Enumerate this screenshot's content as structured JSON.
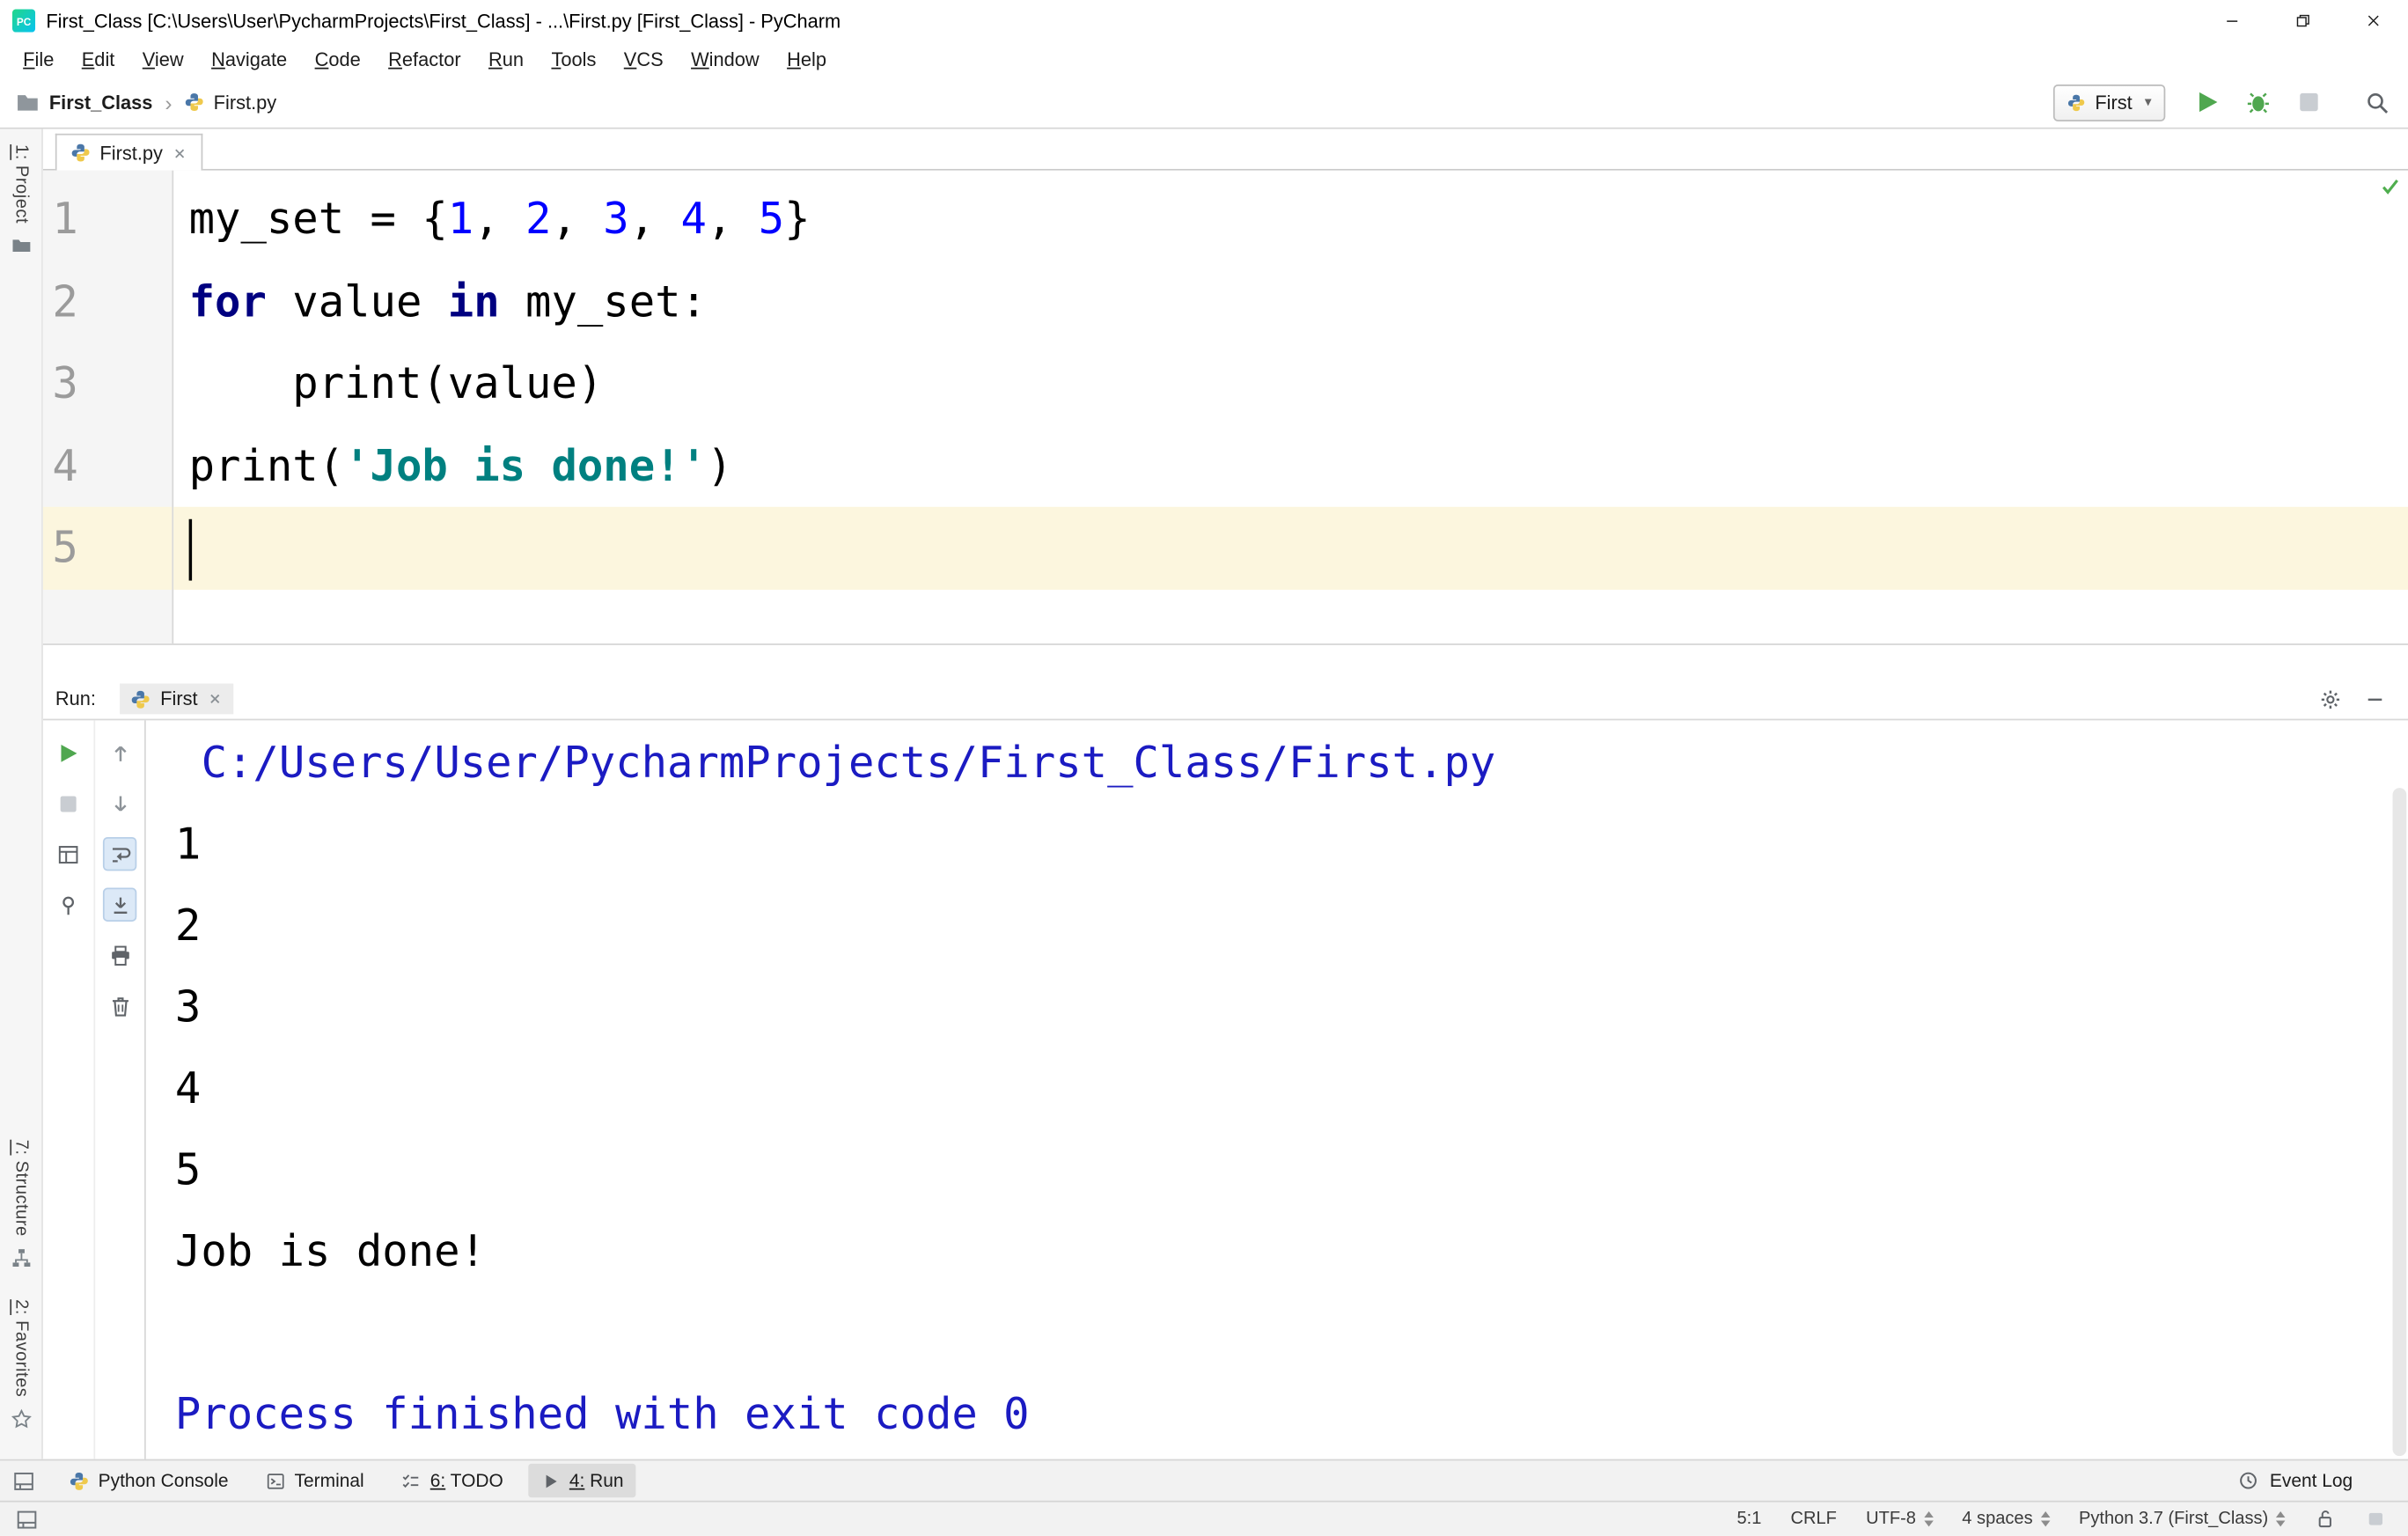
{
  "window": {
    "title": "First_Class [C:\\Users\\User\\PycharmProjects\\First_Class] - ...\\First.py [First_Class] - PyCharm"
  },
  "menubar": {
    "items": [
      "File",
      "Edit",
      "View",
      "Navigate",
      "Code",
      "Refactor",
      "Run",
      "Tools",
      "VCS",
      "Window",
      "Help"
    ]
  },
  "toolbar": {
    "breadcrumb": {
      "project": "First_Class",
      "separator": "›",
      "file": "First.py"
    },
    "run_config": {
      "selected": "First"
    }
  },
  "left_stripe": {
    "buttons": [
      {
        "label": "1: Project",
        "icon": "project-folder-icon"
      },
      {
        "label": "7: Structure",
        "icon": "structure-icon"
      },
      {
        "label": "2: Favorites",
        "icon": "favorites-star-icon"
      }
    ]
  },
  "editor": {
    "tab": {
      "title": "First.py",
      "icon": "python-file-icon"
    },
    "lines": [
      {
        "num": "1",
        "tokens": [
          [
            "p",
            "my_set = {"
          ],
          [
            "n",
            "1"
          ],
          [
            "p",
            ", "
          ],
          [
            "n",
            "2"
          ],
          [
            "p",
            ", "
          ],
          [
            "n",
            "3"
          ],
          [
            "p",
            ", "
          ],
          [
            "n",
            "4"
          ],
          [
            "p",
            ", "
          ],
          [
            "n",
            "5"
          ],
          [
            "p",
            "}"
          ]
        ]
      },
      {
        "num": "2",
        "tokens": [
          [
            "k",
            "for"
          ],
          [
            "p",
            " value "
          ],
          [
            "k",
            "in"
          ],
          [
            "p",
            " my_set:"
          ]
        ]
      },
      {
        "num": "3",
        "tokens": [
          [
            "p",
            "    print(value)"
          ]
        ]
      },
      {
        "num": "4",
        "tokens": [
          [
            "p",
            "print("
          ],
          [
            "s",
            "'Job is done!'"
          ],
          [
            "p",
            ")"
          ]
        ]
      },
      {
        "num": "5",
        "tokens": [],
        "current": true,
        "caret": true
      }
    ]
  },
  "run": {
    "label": "Run:",
    "tab": {
      "title": "First",
      "icon": "python-file-icon"
    },
    "toolbar": {
      "col1": [
        {
          "icon": "rerun-icon",
          "enabled": true
        },
        {
          "icon": "stop-icon",
          "enabled": false
        },
        {
          "icon": "restore-layout-icon",
          "enabled": true
        },
        {
          "icon": "pin-icon",
          "enabled": true
        }
      ],
      "col2": [
        {
          "icon": "up-stack-icon",
          "enabled": false
        },
        {
          "icon": "down-stack-icon",
          "enabled": false
        },
        {
          "icon": "soft-wrap-icon",
          "enabled": true,
          "toggled": true
        },
        {
          "icon": "scroll-end-icon",
          "enabled": true,
          "toggled": true
        },
        {
          "icon": "print-icon",
          "enabled": true
        },
        {
          "icon": "clear-icon",
          "enabled": true
        }
      ]
    },
    "console": {
      "lines": [
        {
          "type": "cmd",
          "text": "C:/Users/User/PycharmProjects/First_Class/First.py"
        },
        {
          "type": "out",
          "text": "1"
        },
        {
          "type": "out",
          "text": "2"
        },
        {
          "type": "out",
          "text": "3"
        },
        {
          "type": "out",
          "text": "4"
        },
        {
          "type": "out",
          "text": "5"
        },
        {
          "type": "out",
          "text": "Job is done!"
        },
        {
          "type": "out",
          "text": ""
        },
        {
          "type": "sys",
          "text": "Process finished with exit code 0"
        }
      ]
    }
  },
  "bottom_bar": {
    "tabs": [
      {
        "label": "Python Console",
        "icon": "python-console-icon"
      },
      {
        "label": "Terminal",
        "icon": "terminal-icon"
      },
      {
        "label": "6: TODO",
        "icon": "todo-icon",
        "mnemonic": true
      },
      {
        "label": "4: Run",
        "icon": "run-small-icon",
        "active": true,
        "mnemonic": true
      }
    ],
    "right": {
      "label": "Event Log",
      "icon": "event-log-icon"
    }
  },
  "statusbar": {
    "position": "5:1",
    "line_ending": "CRLF",
    "encoding": "UTF-8",
    "indent": "4 spaces",
    "interpreter": "Python 3.7 (First_Class)"
  },
  "colors": {
    "keyword": "#000080",
    "number": "#0000ff",
    "string": "#008080",
    "current_line": "#fcf6de",
    "run_green": "#4fa74f",
    "console_info": "#1b1bc2"
  }
}
